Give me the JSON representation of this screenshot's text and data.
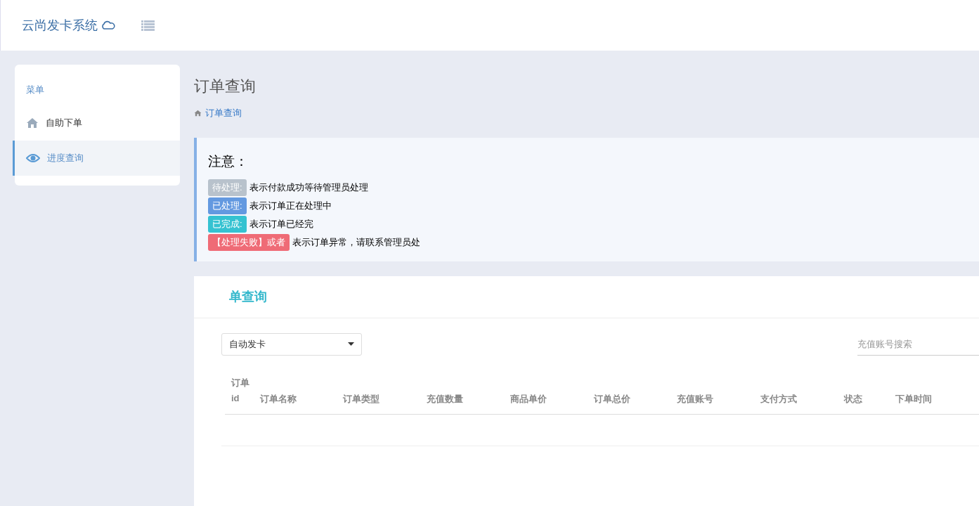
{
  "header": {
    "logo": "云尚发卡系统"
  },
  "sidebar": {
    "heading": "菜单",
    "items": [
      {
        "label": "自助下单",
        "selected": false
      },
      {
        "label": "进度查询",
        "selected": true
      }
    ]
  },
  "page": {
    "title": "订单查询",
    "breadcrumb": "订单查询"
  },
  "notice": {
    "title": "注意：",
    "items": [
      {
        "badge": "待处理:",
        "color": "#b8c2cc",
        "text": "表示付款成功等待管理员处理"
      },
      {
        "badge": "已处理:",
        "color": "#6399e0",
        "text": "表示订单正在处理中"
      },
      {
        "badge": "已完成:",
        "color": "#35c2d1",
        "text": "表示订单已经完"
      },
      {
        "badge": "【处理失败】或者",
        "color": "#ef6b76",
        "text": "表示订单异常，请联系管理员处"
      }
    ]
  },
  "query": {
    "title": "单查询",
    "select": "自动发卡",
    "search": {
      "placeholder": "充值账号搜索"
    },
    "table": {
      "columns": [
        "订单id",
        "订单名称",
        "订单类型",
        "充值数量",
        "商品单价",
        "订单总价",
        "充值账号",
        "支付方式",
        "状态",
        "下单时间"
      ]
    }
  }
}
